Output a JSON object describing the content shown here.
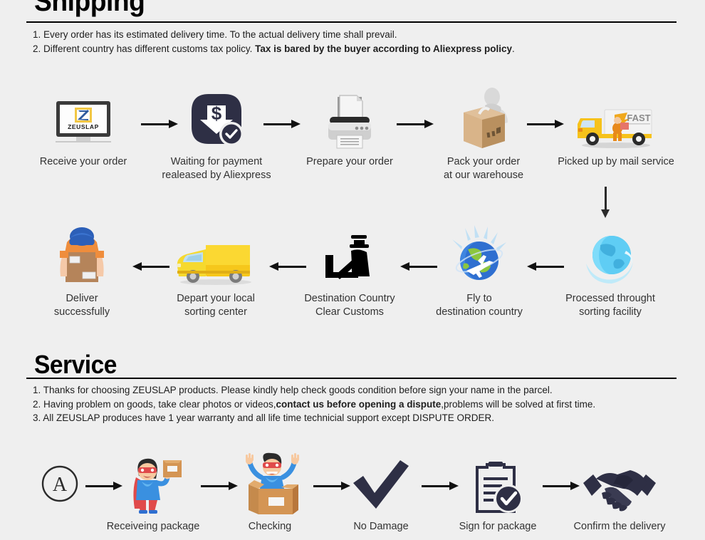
{
  "shipping": {
    "title": "Shipping",
    "notes": [
      {
        "prefix": "1. ",
        "text": "Every order has its estimated delivery time. To the actual delivery time shall prevail.",
        "bold": "",
        "suffix": ""
      },
      {
        "prefix": "2. ",
        "text": "Different country has different customs tax policy. ",
        "bold": "Tax is bared by the buyer according to Aliexpress policy",
        "suffix": "."
      }
    ],
    "row1": [
      {
        "label_line1": "Receive your order",
        "label_line2": "",
        "icon": "monitor-zeuslap-icon"
      },
      {
        "label_line1": "Waiting for payment",
        "label_line2": "realeased by Aliexpress",
        "icon": "payment-dollar-icon"
      },
      {
        "label_line1": "Prepare your order",
        "label_line2": "",
        "icon": "printer-icon"
      },
      {
        "label_line1": "Pack your order",
        "label_line2": "at our warehouse",
        "icon": "packing-box-worker-icon"
      },
      {
        "label_line1": "Picked up by mail service",
        "label_line2": "",
        "icon": "fast-delivery-truck-icon"
      }
    ],
    "row2": [
      {
        "label_line1": "Deliver",
        "label_line2": "successfully",
        "icon": "courier-delivering-box-icon"
      },
      {
        "label_line1": "Depart your local",
        "label_line2": "sorting center",
        "icon": "yellow-van-icon"
      },
      {
        "label_line1": "Destination Country",
        "label_line2": "Clear Customs",
        "icon": "customs-officer-icon"
      },
      {
        "label_line1": "Fly to",
        "label_line2": "destination country",
        "icon": "globe-airplane-icon"
      },
      {
        "label_line1": "Processed throught",
        "label_line2": "sorting facility",
        "icon": "blue-globe-icon"
      }
    ],
    "truck_badge": "FAST",
    "monitor_brand": "ZEUSLAP"
  },
  "service": {
    "title": "Service",
    "notes": [
      {
        "prefix": "1. ",
        "text": "Thanks for choosing ZEUSLAP products. Please kindly help check goods condition before sign your name in the parcel.",
        "bold": "",
        "suffix": ""
      },
      {
        "prefix": "2. ",
        "text": "Having problem on goods, take clear photos or videos,",
        "bold": "contact us before opening a dispute",
        "suffix": ",problems will be solved at first time."
      },
      {
        "prefix": "3. ",
        "text": "All ZEUSLAP produces have 1 year warranty and all life time technicial support except DISPUTE ORDER.",
        "bold": "",
        "suffix": ""
      }
    ],
    "row": [
      {
        "label_line1": "",
        "label_line2": "",
        "icon": "circled-a-icon",
        "badge": "A"
      },
      {
        "label_line1": "Receiveing package",
        "label_line2": "",
        "icon": "superhero-with-box-icon"
      },
      {
        "label_line1": "Checking",
        "label_line2": "",
        "icon": "superhero-in-box-icon"
      },
      {
        "label_line1": "No Damage",
        "label_line2": "",
        "icon": "checkmark-icon"
      },
      {
        "label_line1": "Sign for package",
        "label_line2": "",
        "icon": "clipboard-check-icon"
      },
      {
        "label_line1": "Confirm the delivery",
        "label_line2": "",
        "icon": "handshake-icon"
      }
    ]
  },
  "colors": {
    "background": "#efefef",
    "text": "#2b2b2b",
    "dark_navy": "#2e2f45",
    "yellow": "#f5c018",
    "orange": "#e8861e",
    "blue": "#2f7fd1",
    "red": "#e8453c",
    "box_tan": "#c9a173"
  }
}
